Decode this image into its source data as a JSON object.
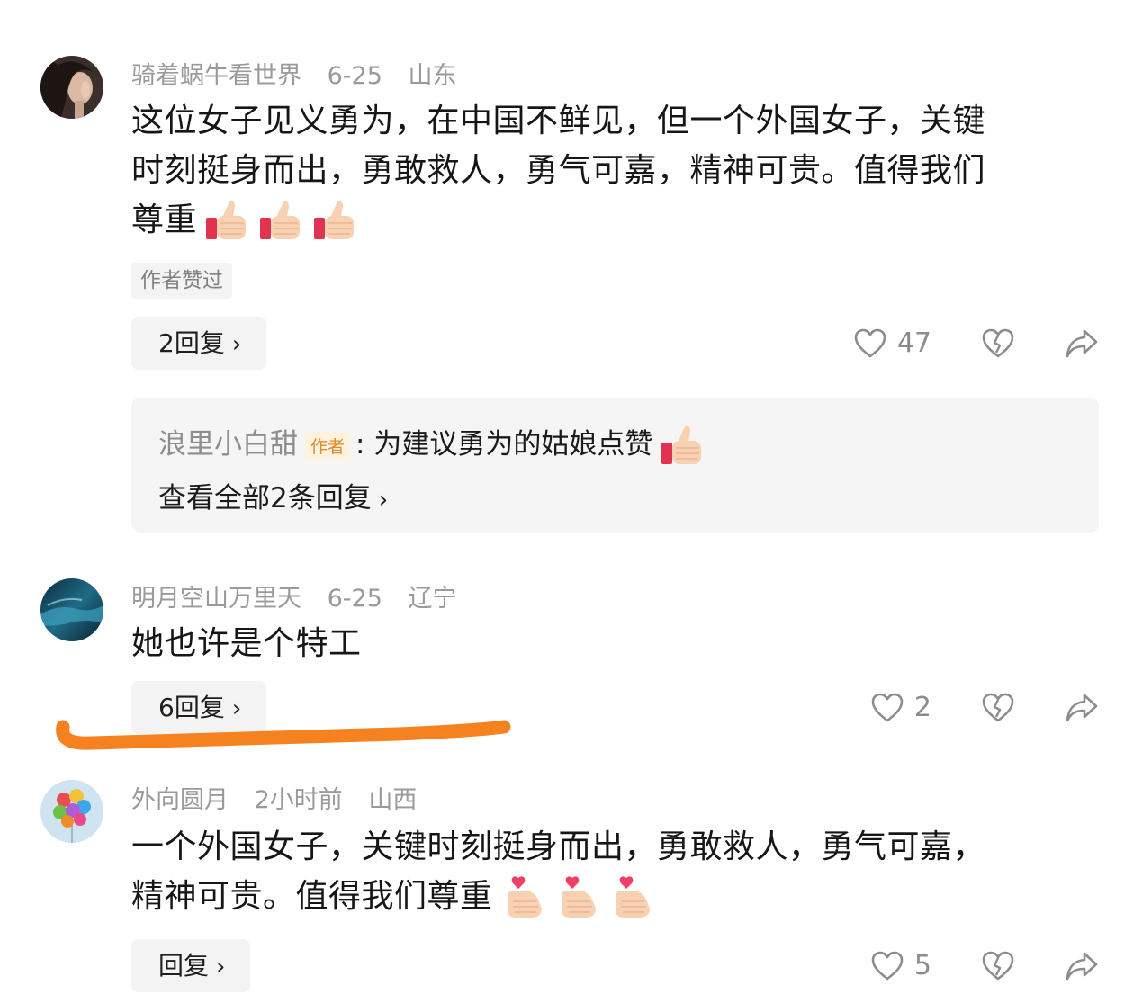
{
  "comments": [
    {
      "username": "骑着蜗牛看世界",
      "date": "6-25",
      "location": "山东",
      "text_lines": [
        "这位女子见义勇为，在中国不鲜见，但一个外国女子，关键",
        "时刻挺身而出，勇敢救人，勇气可嘉，精神可贵。值得我们",
        "尊重"
      ],
      "emoji": "thumbs-up",
      "emoji_count": 3,
      "author_liked": "作者赞过",
      "reply_button": "2回复",
      "likes": "47",
      "reply_box": {
        "name": "浪里小白甜",
        "tag": "作者",
        "text": ": 为建议勇为的姑娘点赞",
        "view_all": "查看全部2条回复"
      }
    },
    {
      "username": "明月空山万里天",
      "date": "6-25",
      "location": "辽宁",
      "text_lines": [
        "她也许是个特工"
      ],
      "reply_button": "6回复",
      "likes": "2"
    },
    {
      "username": "外向圆月",
      "date": "2小时前",
      "location": "山西",
      "text_lines": [
        "一个外国女子，关键时刻挺身而出，勇敢救人，勇气可嘉，",
        "精神可贵。值得我们尊重"
      ],
      "emoji": "finger-heart",
      "emoji_count": 3,
      "reply_button": "回复",
      "likes": "5"
    }
  ],
  "chevron": "›",
  "colors": {
    "highlight_underline": "#f5821f",
    "meta_gray": "#9a9a9a",
    "tag_orange": "#e08a2a"
  }
}
